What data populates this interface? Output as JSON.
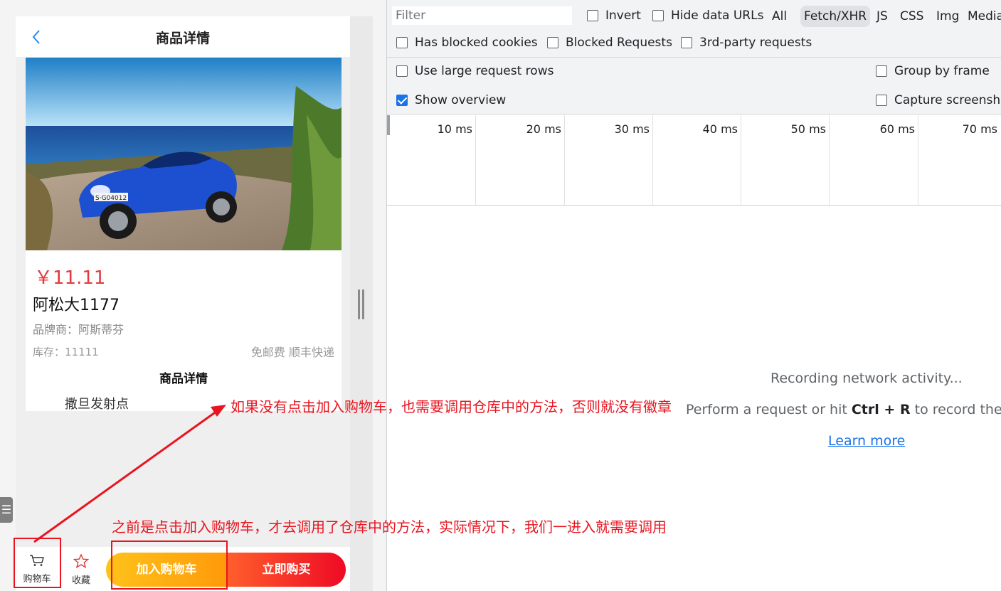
{
  "mobile": {
    "nav": {
      "back_icon": "chevron-left-icon",
      "title": "商品详情"
    },
    "goods": {
      "image": "blue sports convertible car on coastal road",
      "price": "￥11.11",
      "name": "阿松大1177",
      "brand": "品牌商：阿斯蒂芬",
      "stock": "库存：11111",
      "shipping": "免邮费 顺丰快递",
      "detail_heading": "商品详情",
      "detail_text": "撒旦发射点"
    },
    "bottom_bar": {
      "cart_label": "购物车",
      "cart_icon": "cart-icon",
      "fav_label": "收藏",
      "fav_icon": "star-icon",
      "add_cart": "加入购物车",
      "buy_now": "立即购买"
    },
    "side_tab_icon": "menu-icon"
  },
  "devtools": {
    "filter_placeholder": "Filter",
    "checkboxes": {
      "invert": {
        "label": "Invert",
        "checked": false
      },
      "hide_data_urls": {
        "label": "Hide data URLs",
        "checked": false
      },
      "blocked_cookies": {
        "label": "Has blocked cookies",
        "checked": false
      },
      "blocked_requests": {
        "label": "Blocked Requests",
        "checked": false
      },
      "third_party": {
        "label": "3rd-party requests",
        "checked": false
      },
      "large_rows": {
        "label": "Use large request rows",
        "checked": false
      },
      "group_by_frame": {
        "label": "Group by frame",
        "checked": false
      },
      "show_overview": {
        "label": "Show overview",
        "checked": true
      },
      "capture_screenshots": {
        "label": "Capture screenshots",
        "checked": false
      }
    },
    "type_filters": [
      {
        "label": "All",
        "active": false
      },
      {
        "label": "Fetch/XHR",
        "active": true
      },
      {
        "label": "JS",
        "active": false
      },
      {
        "label": "CSS",
        "active": false
      },
      {
        "label": "Img",
        "active": false
      },
      {
        "label": "Media",
        "active": false
      }
    ],
    "timeline_ticks": [
      "10 ms",
      "20 ms",
      "30 ms",
      "40 ms",
      "50 ms",
      "60 ms",
      "70 ms"
    ],
    "empty_state": {
      "title": "Recording network activity...",
      "hint_prefix": "Perform a request or hit ",
      "hint_key1": "Ctrl",
      "hint_plus": " + ",
      "hint_key2": "R",
      "hint_suffix": " to record the reload.",
      "learn_more": "Learn more"
    }
  },
  "annotations": {
    "note_top": "如果没有点击加入购物车，也需要调用仓库中的方法，否则就没有徽章",
    "note_bottom": "之前是点击加入购物车，才去调用了仓库中的方法，实际情况下，我们一进入就需要调用",
    "color": "#e8141f"
  }
}
